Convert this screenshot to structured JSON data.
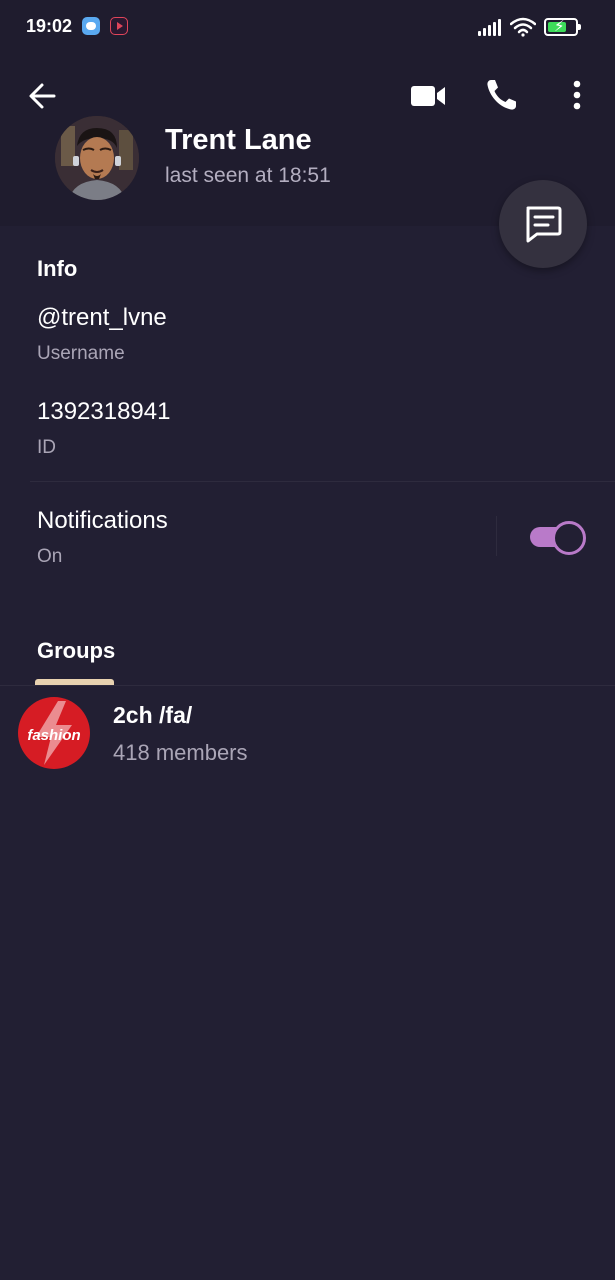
{
  "status_bar": {
    "time": "19:02",
    "battery_level": 0.7
  },
  "header": {
    "back_icon": "arrow-left-icon",
    "video_icon": "video-camera-icon",
    "call_icon": "phone-icon",
    "more_icon": "more-vertical-icon",
    "contact_name": "Trent Lane",
    "status": "last seen at 18:51",
    "fab_icon": "message-icon"
  },
  "info": {
    "title": "Info",
    "username_value": "@trent_lvne",
    "username_label": "Username",
    "id_value": "1392318941",
    "id_label": "ID",
    "notifications_label": "Notifications",
    "notifications_state": "On",
    "notifications_enabled": true
  },
  "groups": {
    "title": "Groups",
    "items": [
      {
        "name": "2ch /fa/",
        "members": "418 members",
        "logo_text": "fashion"
      }
    ]
  },
  "colors": {
    "background": "#221f33",
    "header": "#1f1c2e",
    "accent": "#b97ac9",
    "tab_indicator": "#e8d2b0",
    "group_logo": "#d61c24"
  }
}
